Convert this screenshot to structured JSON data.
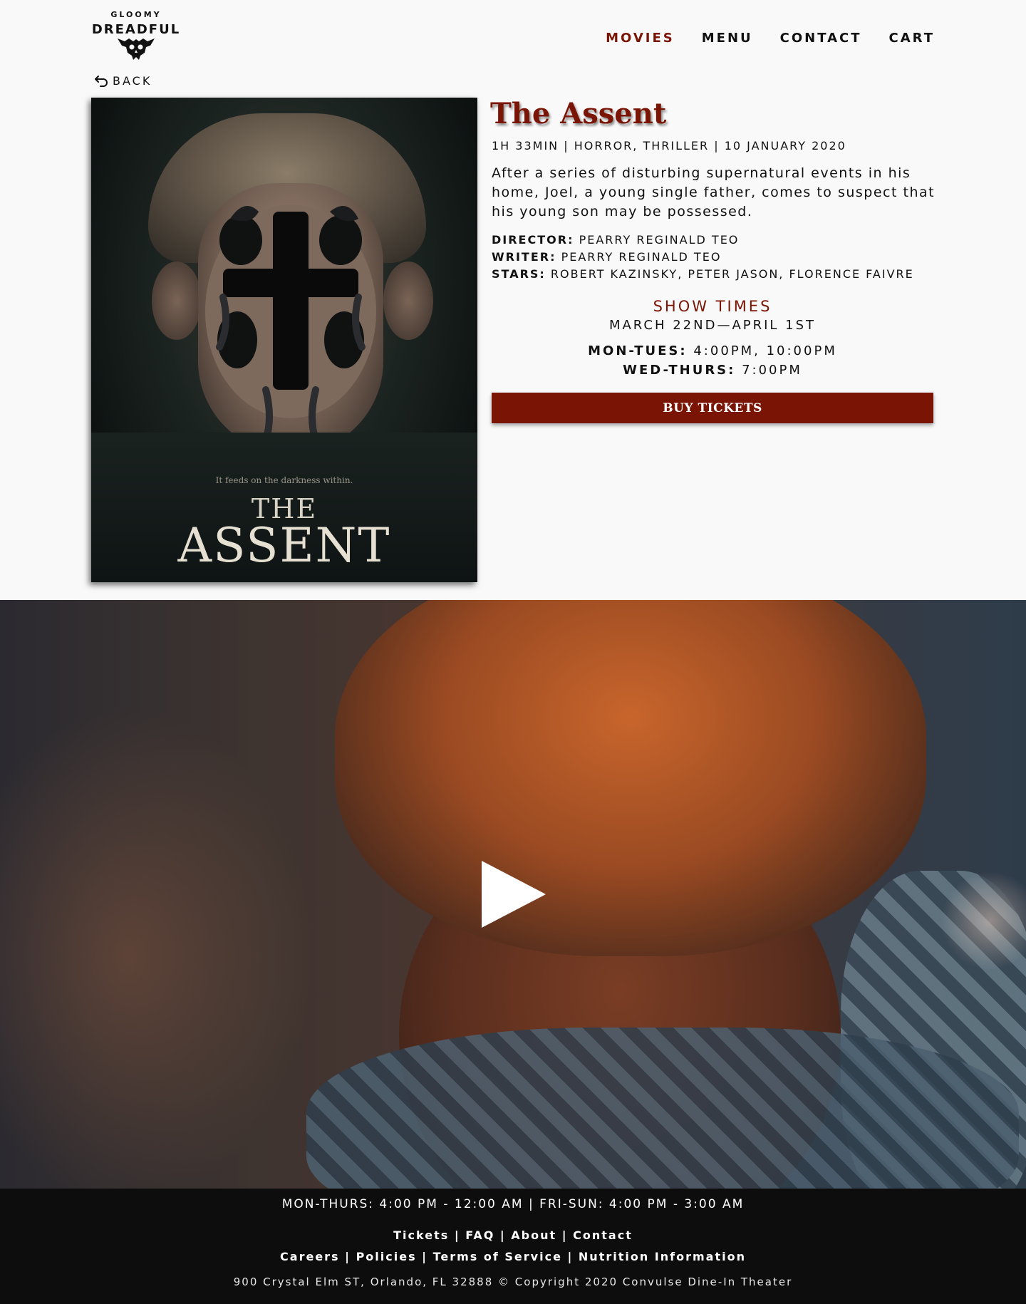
{
  "brand": {
    "small": "GLOOMY",
    "big": "DREADFUL"
  },
  "nav": [
    {
      "label": "MOVIES",
      "active": true
    },
    {
      "label": "MENU"
    },
    {
      "label": "CONTACT"
    },
    {
      "label": "CART"
    }
  ],
  "back_label": "BACK",
  "poster": {
    "tagline": "It feeds on the darkness within.",
    "title_the": "THE",
    "title_main": "ASSENT"
  },
  "movie": {
    "title": "The Assent",
    "meta": "1H 33MIN | HORROR, THRILLER | 10 JANUARY 2020",
    "synopsis": "After a series of disturbing supernatural events in his home, Joel, a young single father, comes to suspect that his young son may be possessed.",
    "credits": [
      {
        "label": "DIRECTOR:",
        "value": "PEARRY REGINALD TEO"
      },
      {
        "label": "WRITER:",
        "value": "PEARRY REGINALD TEO"
      },
      {
        "label": "STARS:",
        "value": "ROBERT KAZINSKY, PETER JASON, FLORENCE FAIVRE"
      }
    ]
  },
  "showtimes": {
    "heading": "SHOW TIMES",
    "range": "MARCH 22ND—APRIL 1ST",
    "rows": [
      {
        "days": "MON-TUES:",
        "times": "4:00PM, 10:00PM"
      },
      {
        "days": "WED-THURS:",
        "times": "7:00PM"
      }
    ]
  },
  "buy_label": "BUY TICKETS",
  "footer": {
    "hours": "MON-THURS: 4:00 PM - 12:00 AM | FRI-SUN: 4:00 PM - 3:00 AM",
    "links_row1": [
      "Tickets",
      "FAQ",
      "About",
      "Contact"
    ],
    "links_row2": [
      "Careers",
      "Policies",
      "Terms of Service",
      "Nutrition Information"
    ],
    "copyright": "900 Crystal Elm ST, Orlando, FL 32888 © Copyright 2020 Convulse Dine-In Theater"
  },
  "colors": {
    "accent": "#7a1505",
    "footer_bg": "#0d0d0d",
    "page_bg": "#f9f9f9"
  },
  "icons": {
    "back": "undo-arrow-icon",
    "play": "play-icon",
    "logo": "skull-icon"
  }
}
